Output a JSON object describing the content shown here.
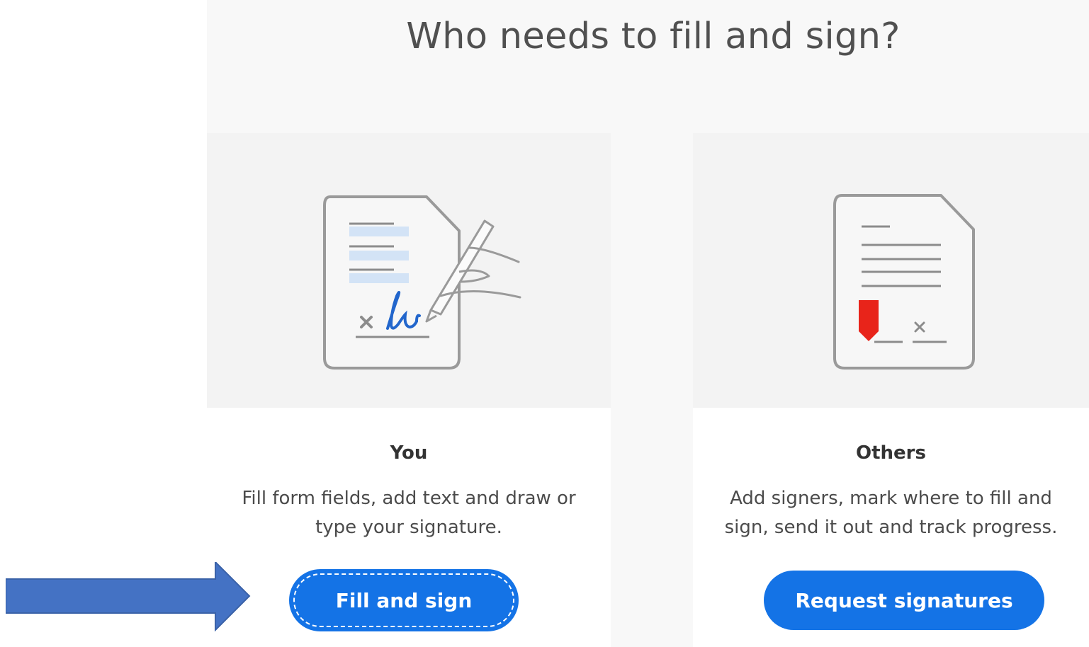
{
  "title": "Who needs to fill and sign?",
  "cards": [
    {
      "heading": "You",
      "description": "Fill form fields, add text and draw or type your signature.",
      "button_label": "Fill and sign",
      "illustration_icon": "self-sign-document-icon"
    },
    {
      "heading": "Others",
      "description": "Add signers, mark where to fill and sign, send it out and track progress.",
      "button_label": "Request signatures",
      "illustration_icon": "request-signature-document-icon"
    }
  ],
  "annotation": {
    "icon": "pointer-arrow-icon",
    "color": "#4472c4"
  },
  "colors": {
    "accent": "#1473e6",
    "signature_blue": "#2266cc",
    "marker_red": "#e8241a"
  }
}
